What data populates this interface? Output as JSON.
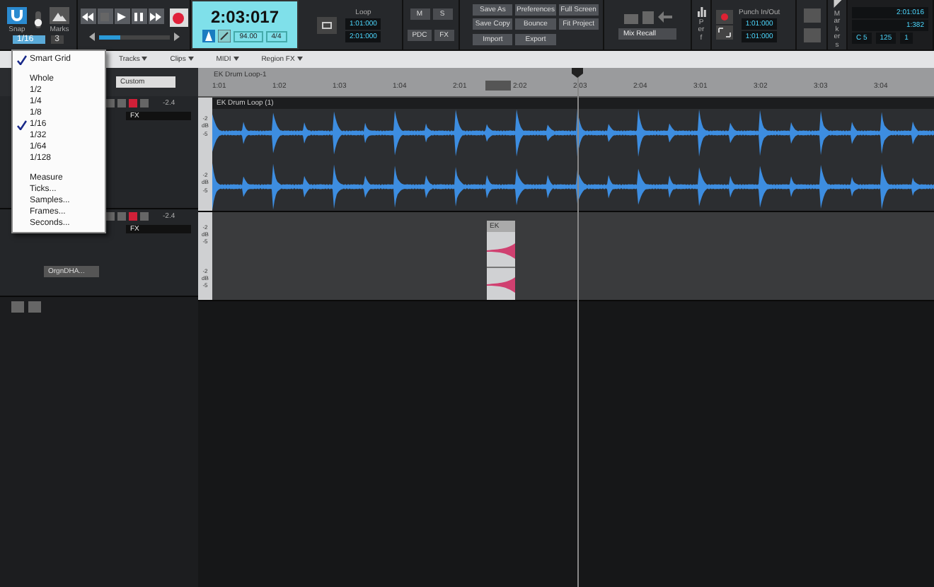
{
  "control_bar": {
    "snap": {
      "label": "Snap",
      "marks_label": "Marks",
      "value": "1/16",
      "count": "3"
    },
    "transport": {
      "time": "2:03:017",
      "tempo": "94.00",
      "meter": "4/4",
      "level": 0.3
    },
    "loop": {
      "label": "Loop",
      "start": "1:01:000",
      "end": "2:01:000"
    },
    "mix_buttons": [
      "M",
      "S",
      "PDC",
      "FX"
    ],
    "file_buttons": [
      "Save As",
      "Preferences",
      "Full Screen",
      "Save Copy",
      "Bounce",
      "Fit Project",
      "Import",
      "Export"
    ],
    "mix_recall": "Mix Recall",
    "perf_label": "Perf",
    "punch": {
      "label": "Punch In/Out",
      "start": "1:01:000",
      "end": "1:01:000"
    },
    "markers_label": "Markers",
    "now": {
      "time": "2:01:016",
      "beat": "1:382",
      "note": "C 5",
      "velocity": "125",
      "channel": "1"
    }
  },
  "menubar": [
    "Tracks",
    "Clips",
    "MIDI",
    "Region FX"
  ],
  "view_select": "Custom",
  "ruler": {
    "clip": "EK Drum Loop-1",
    "ticks": [
      "1:01",
      "1:02",
      "1:03",
      "1:04",
      "2:01",
      "2:02",
      "2:03",
      "2:04",
      "3:01",
      "3:02",
      "3:03",
      "3:04"
    ],
    "playhead": {
      "level": 0.516
    }
  },
  "tracks": [
    {
      "volume": "-2.4",
      "fx": "FX",
      "scales": [
        [
          "-2",
          "dB",
          "-5"
        ],
        [
          "-2",
          "dB",
          "-5"
        ]
      ],
      "clip": {
        "name": "EK Drum Loop (1)",
        "kind": "audio"
      }
    },
    {
      "volume": "-2.4",
      "fx": "FX",
      "output": "OrgnDHA...",
      "scales": [
        [
          "-2",
          "dB",
          "-5"
        ],
        [
          "-2",
          "dB",
          "-5"
        ]
      ],
      "clip": {
        "name": "EK",
        "kind": "short"
      }
    }
  ],
  "snap_menu": {
    "sections": [
      {
        "items": [
          {
            "label": "Smart Grid",
            "checked": true
          }
        ]
      },
      {
        "items": [
          {
            "label": "Whole",
            "checked": false
          },
          {
            "label": "1/2",
            "checked": false
          },
          {
            "label": "1/4",
            "checked": false
          },
          {
            "label": "1/8",
            "checked": false
          },
          {
            "label": "1/16",
            "checked": true
          },
          {
            "label": "1/32",
            "checked": false
          },
          {
            "label": "1/64",
            "checked": false
          },
          {
            "label": "1/128",
            "checked": false
          }
        ]
      },
      {
        "items": [
          {
            "label": "Measure",
            "checked": false
          },
          {
            "label": "Ticks...",
            "checked": false
          },
          {
            "label": "Samples...",
            "checked": false
          },
          {
            "label": "Frames...",
            "checked": false
          },
          {
            "label": "Seconds...",
            "checked": false
          }
        ]
      }
    ]
  }
}
